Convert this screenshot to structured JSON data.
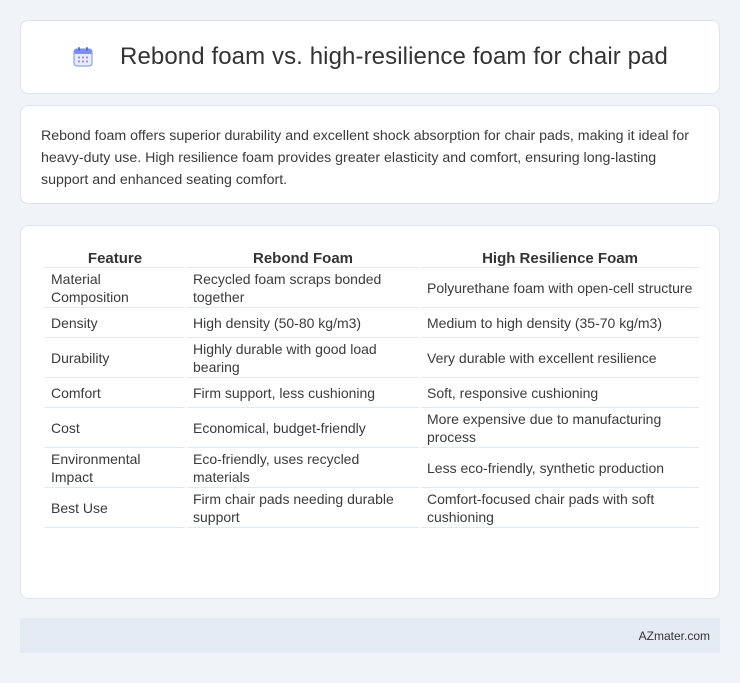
{
  "header": {
    "title": "Rebond foam vs. high-resilience foam for chair pad",
    "icon": "calendar-icon"
  },
  "summary": {
    "text": "Rebond foam offers superior durability and excellent shock absorption for chair pads, making it ideal for heavy-duty use. High resilience foam provides greater elasticity and comfort, ensuring long-lasting support and enhanced seating comfort."
  },
  "table": {
    "headers": [
      "Feature",
      "Rebond Foam",
      "High Resilience Foam"
    ],
    "rows": [
      [
        "Material Composition",
        "Recycled foam scraps bonded together",
        "Polyurethane foam with open-cell structure"
      ],
      [
        "Density",
        "High density (50-80 kg/m3)",
        "Medium to high density (35-70 kg/m3)"
      ],
      [
        "Durability",
        "Highly durable with good load bearing",
        "Very durable with excellent resilience"
      ],
      [
        "Comfort",
        "Firm support, less cushioning",
        "Soft, responsive cushioning"
      ],
      [
        "Cost",
        "Economical, budget-friendly",
        "More expensive due to manufacturing process"
      ],
      [
        "Environmental Impact",
        "Eco-friendly, uses recycled materials",
        "Less eco-friendly, synthetic production"
      ],
      [
        "Best Use",
        "Firm chair pads needing durable support",
        "Comfort-focused chair pads with soft cushioning"
      ]
    ]
  },
  "footer": {
    "text": "AZmater.com"
  },
  "colors": {
    "background": "#f0f4f9",
    "card": "#ffffff",
    "footer": "#e5ebf5",
    "icon_accent": "#7b8ff0"
  }
}
